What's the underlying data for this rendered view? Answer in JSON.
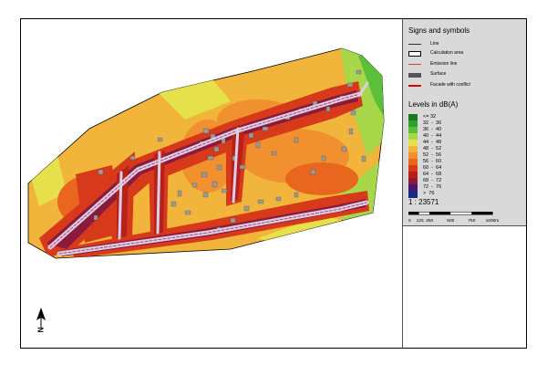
{
  "legend": {
    "symbols_title": "Signs and symbols",
    "symbols": [
      {
        "label": "Line",
        "icon": "line-symbol",
        "color": "#333333"
      },
      {
        "label": "Calculation area",
        "icon": "calculation-area-symbol",
        "color": "#000000"
      },
      {
        "label": "Emission line",
        "icon": "emission-line-symbol",
        "color": "#d04040"
      },
      {
        "label": "Surface",
        "icon": "surface-symbol",
        "color": "#555555"
      },
      {
        "label": "Facade with conflict",
        "icon": "facade-conflict-symbol",
        "color": "#e00000"
      }
    ],
    "levels_title": "Levels in dB(A)",
    "levels": [
      {
        "label": "<= 32",
        "color": "#1a7a1a"
      },
      {
        "label": "32  -  36",
        "color": "#2f9f2f"
      },
      {
        "label": "36  -  40",
        "color": "#5cbf3a"
      },
      {
        "label": "40  -  44",
        "color": "#a8d84a"
      },
      {
        "label": "44  -  48",
        "color": "#e6e04a"
      },
      {
        "label": "48  -  52",
        "color": "#f2b53c"
      },
      {
        "label": "52  -  56",
        "color": "#f0902e"
      },
      {
        "label": "56  -  60",
        "color": "#e8661e"
      },
      {
        "label": "60  -  64",
        "color": "#d63a1a"
      },
      {
        "label": "64  -  68",
        "color": "#b8201c"
      },
      {
        "label": "68  -  72",
        "color": "#8c1a3c"
      },
      {
        "label": "72  -  76",
        "color": "#4a1670"
      },
      {
        "label": ">  76",
        "color": "#1a2a80"
      }
    ],
    "scale_ratio": "1 : 23571",
    "scalebar_ticks": [
      "0",
      "125",
      "250",
      "500",
      "750",
      "1000"
    ],
    "scalebar_unit": "m"
  },
  "north_arrow": {
    "label": "N"
  }
}
